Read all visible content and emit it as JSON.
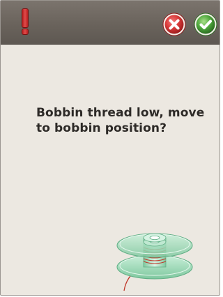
{
  "dialog": {
    "message": "Bobbin thread low, move to bobbin position?"
  },
  "icons": {
    "warning": "exclamation-icon",
    "cancel": "close-icon",
    "confirm": "checkmark-icon",
    "illustration": "bobbin-icon"
  },
  "colors": {
    "titlebar": "#6a635c",
    "background": "#ece8e1",
    "warning": "#d32f2f",
    "cancel": "#d93a3a",
    "confirm": "#4fa83d",
    "bobbin": "#8fd1ad",
    "thread": "#c0392b"
  }
}
